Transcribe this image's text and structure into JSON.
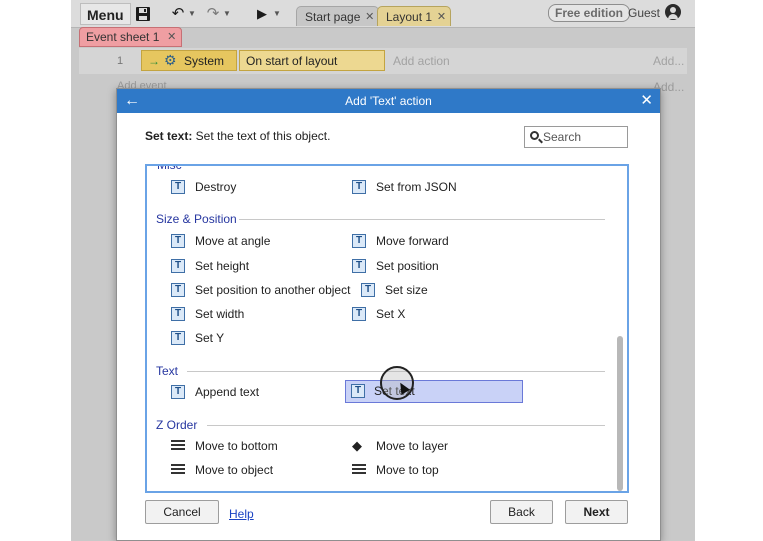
{
  "toolbar": {
    "menu_label": "Menu",
    "tabs": [
      {
        "label": "Start page",
        "active": false
      },
      {
        "label": "Layout 1",
        "active": true
      }
    ],
    "edition_badge": "Free edition",
    "user_label": "Guest",
    "icons": [
      "save-icon",
      "undo-icon",
      "redo-icon",
      "play-icon"
    ]
  },
  "event_sheet": {
    "tab_label": "Event sheet 1",
    "row_number": "1",
    "condition_object": "System",
    "condition_text": "On start of layout",
    "add_action": "Add action",
    "add_link": "Add...",
    "add_event": "Add event",
    "add_link_2": "Add..."
  },
  "dialog": {
    "title": "Add 'Text' action",
    "description_bold": "Set text:",
    "description_rest": " Set the text of this object.",
    "search_placeholder": "Search",
    "partial_header": "Misc",
    "groups": [
      {
        "items": [
          "Destroy",
          "Set from JSON"
        ]
      },
      {
        "name": "Size & Position",
        "items": [
          "Move at angle",
          "Move forward",
          "Set height",
          "Set position",
          "Set position to another object",
          "Set size",
          "Set width",
          "Set X",
          "Set Y"
        ]
      },
      {
        "name": "Text",
        "items": [
          "Append text",
          "Set text"
        ],
        "selected": "Set text"
      },
      {
        "name": "Z Order",
        "items": [
          "Move to bottom",
          "Move to layer",
          "Move to object",
          "Move to top"
        ]
      }
    ],
    "buttons": {
      "cancel": "Cancel",
      "help": "Help",
      "back": "Back",
      "next": "Next"
    }
  },
  "colors": {
    "dialog_title_bg": "#2f79c8",
    "group_header": "#2636a0",
    "selection_bg": "#c9d2f7",
    "listbox_border": "#6aa3e6",
    "event_sheet_tab": "#ef9ea2",
    "condition_bg": "#e6c65f"
  }
}
